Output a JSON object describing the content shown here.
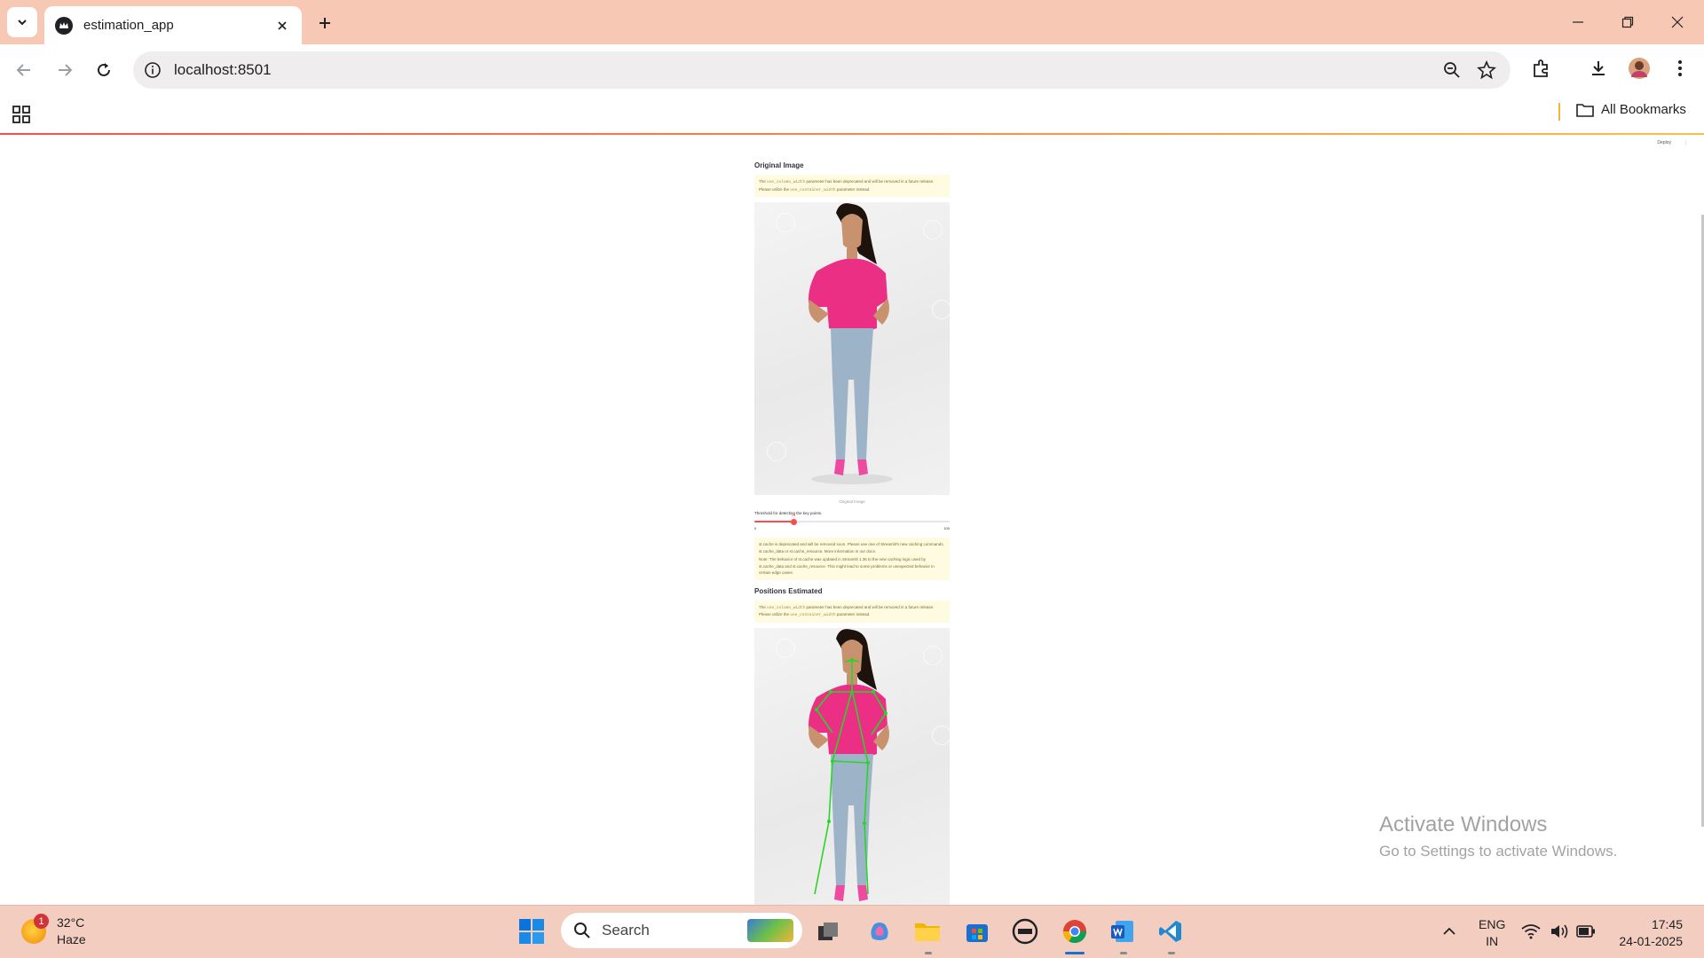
{
  "browser": {
    "tab_title": "estimation_app",
    "url": "localhost:8501",
    "bookmarks_label": "All Bookmarks"
  },
  "page": {
    "deploy_label": "Deploy",
    "section1_title": "Original Image",
    "warning1_pre": "The ",
    "warning1_code1": "use_column_width",
    "warning1_mid": " parameter has been deprecated and will be removed in a future release. Please utilize the ",
    "warning1_code2": "use_container_width",
    "warning1_post": " parameter instead.",
    "image1_caption": "Original Image",
    "slider_label": "Threshold for detecting the key points.",
    "slider": {
      "value": 20,
      "min": 0,
      "max": 100,
      "value_label": "20",
      "min_label": "0",
      "max_label": "100"
    },
    "cache_warning_line1": "st.cache is deprecated and will be removed soon. Please use one of Streamlit's new caching commands, st.cache_data or st.cache_resource. More information in our docs.",
    "cache_warning_line2": "Note: The behavior of st.cache was updated in Streamlit 1.36 to the new caching logic used by st.cache_data and st.cache_resource. This might lead to some problems or unexpected behavior in certain edge cases.",
    "section2_title": "Positions Estimated",
    "warning2_pre": "The ",
    "warning2_code1": "use_column_width",
    "warning2_mid": " parameter has been deprecated and will be removed in a future release. Please utilize the ",
    "warning2_code2": "use_container_width",
    "warning2_post": " parameter instead."
  },
  "watermark": {
    "line1": "Activate Windows",
    "line2": "Go to Settings to activate Windows."
  },
  "taskbar": {
    "weather_temp": "32°C",
    "weather_desc": "Haze",
    "weather_badge": "1",
    "search_placeholder": "Search",
    "lang_line1": "ENG",
    "lang_line2": "IN",
    "time": "17:45",
    "date": "24-01-2025"
  },
  "colors": {
    "tabbar": "#f7c9b4",
    "accent": "#ff4b4b",
    "warning_bg": "#fffbe0",
    "skeleton": "#28d628",
    "shirt": "#ea2f84"
  }
}
